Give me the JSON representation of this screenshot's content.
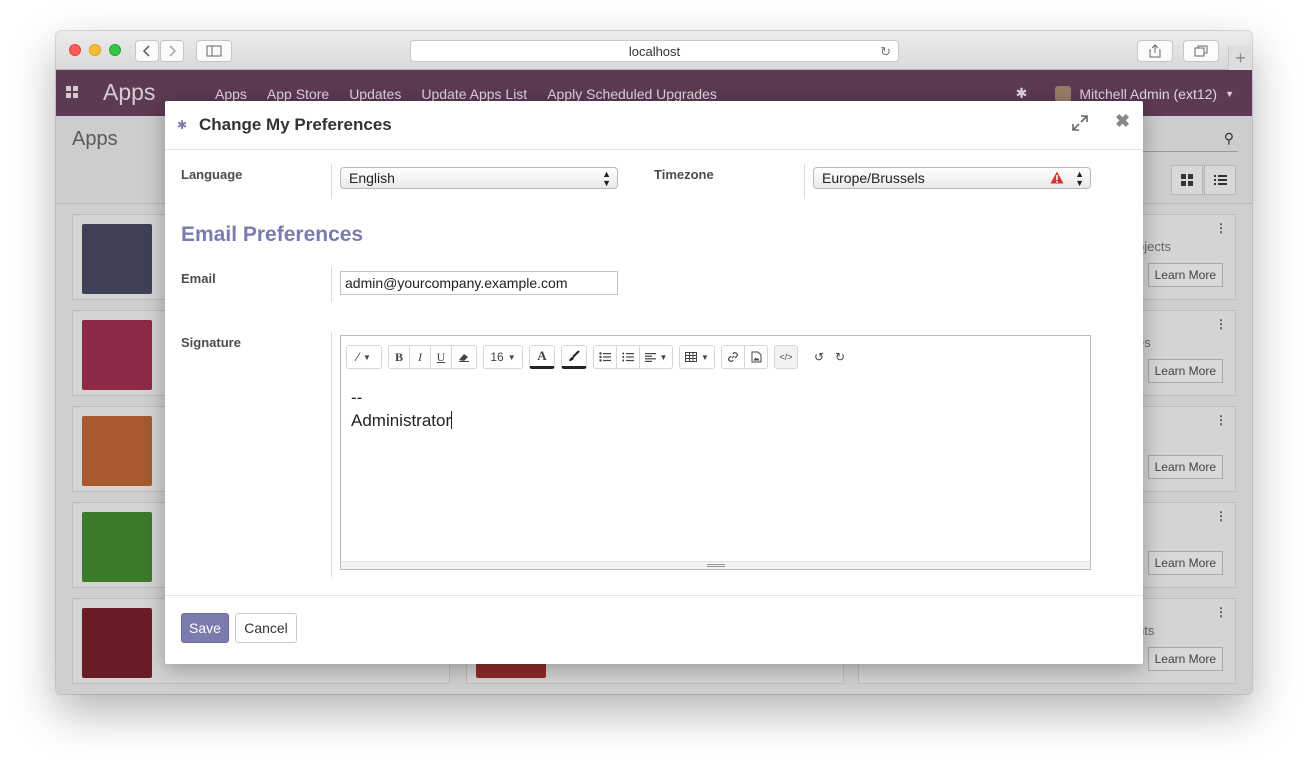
{
  "browser": {
    "url": "localhost"
  },
  "navbar": {
    "app_name": "Apps",
    "menu": [
      "Apps",
      "App Store",
      "Updates",
      "Update Apps List",
      "Apply Scheduled Upgrades"
    ],
    "user": "Mitchell Admin (ext12)"
  },
  "background": {
    "page_title": "Apps",
    "cards": [
      {
        "snippet": "ojects",
        "button": "Learn More"
      },
      {
        "snippet": "es",
        "button": "Learn More"
      },
      {
        "snippet": "",
        "button": "Learn More"
      },
      {
        "snippet": "",
        "button": "Learn More"
      },
      {
        "snippet": "nts",
        "button": "Learn More"
      }
    ]
  },
  "dialog": {
    "title": "Change My Preferences",
    "language": {
      "label": "Language",
      "value": "English"
    },
    "timezone": {
      "label": "Timezone",
      "value": "Europe/Brussels"
    },
    "email_section_title": "Email Preferences",
    "email": {
      "label": "Email",
      "value": "admin@yourcompany.example.com"
    },
    "signature": {
      "label": "Signature",
      "font_size": "16",
      "lines": [
        "--",
        "Administrator"
      ]
    },
    "save_label": "Save",
    "cancel_label": "Cancel"
  },
  "colors": {
    "navbar": "#5d3a53",
    "primary": "#7c7bad",
    "warning": "#d9302c"
  }
}
